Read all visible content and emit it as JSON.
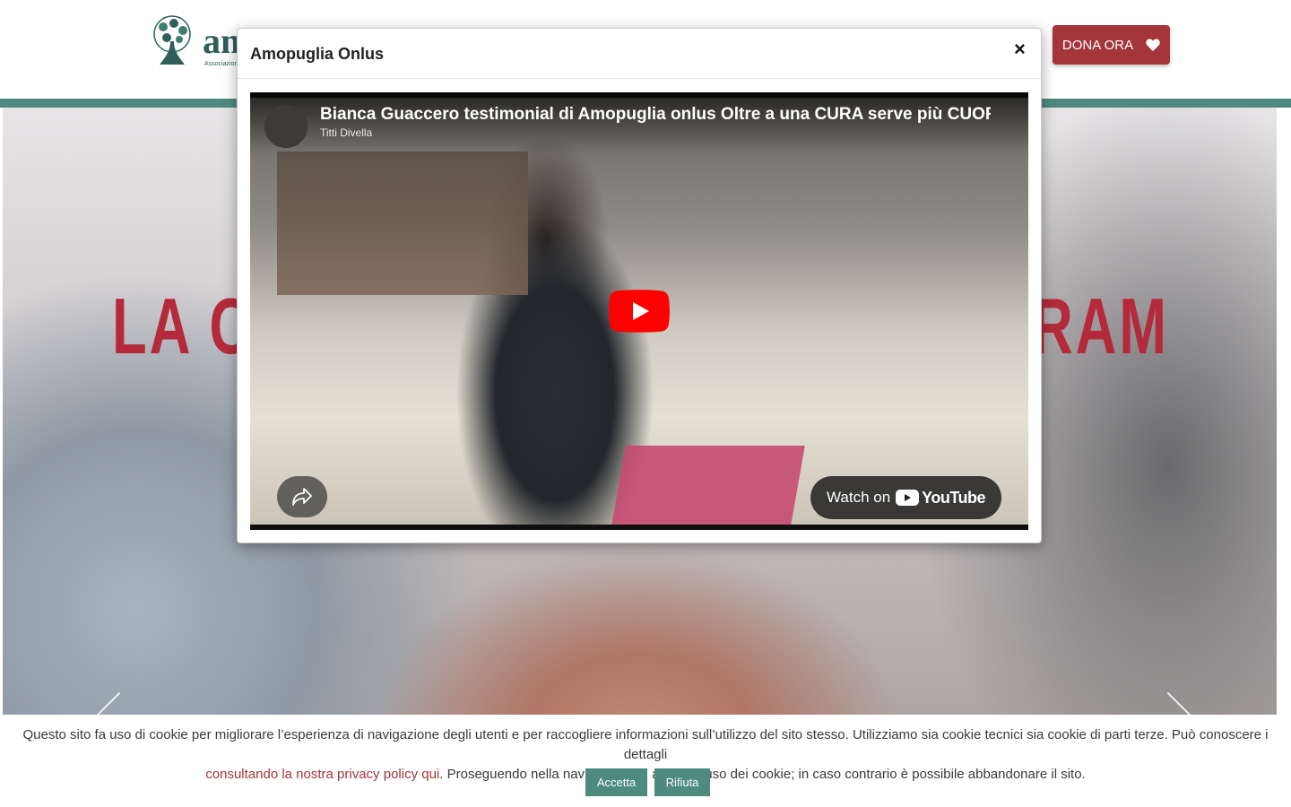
{
  "header": {
    "logo_text": "am",
    "logo_subtitle": "Associazione",
    "donate_label": "DONA ORA",
    "donate_icon": "heart-icon"
  },
  "hero": {
    "text_left": "LA C",
    "text_right": "RAM",
    "accent_color": "#b52a3a"
  },
  "modal": {
    "title": "Amopuglia Onlus",
    "close_label": "×",
    "video": {
      "title": "Bianca Guaccero testimonial di Amopuglia onlus Oltre a una CURA serve più CUORE",
      "channel": "Titti Divella",
      "watch_label": "Watch on",
      "youtube_label": "YouTube"
    }
  },
  "cookie": {
    "text_before": "Questo sito fa uso di cookie per migliorare l’esperienza di navigazione degli utenti e per raccogliere informazioni sull’utilizzo del sito stesso. Utilizziamo sia cookie tecnici sia cookie di parti terze. Può conoscere i dettagli",
    "link_text": "consultando la nostra privacy policy qui",
    "text_after": ". Proseguendo nella navigazione si accetta l’uso dei cookie; in caso contrario è possibile abbandonare il sito.",
    "accept_label": "Accetta",
    "reject_label": "Rifiuta"
  },
  "colors": {
    "teal": "#4f8a7e",
    "brand_red": "#a3353b",
    "youtube_red": "#ff0000"
  }
}
